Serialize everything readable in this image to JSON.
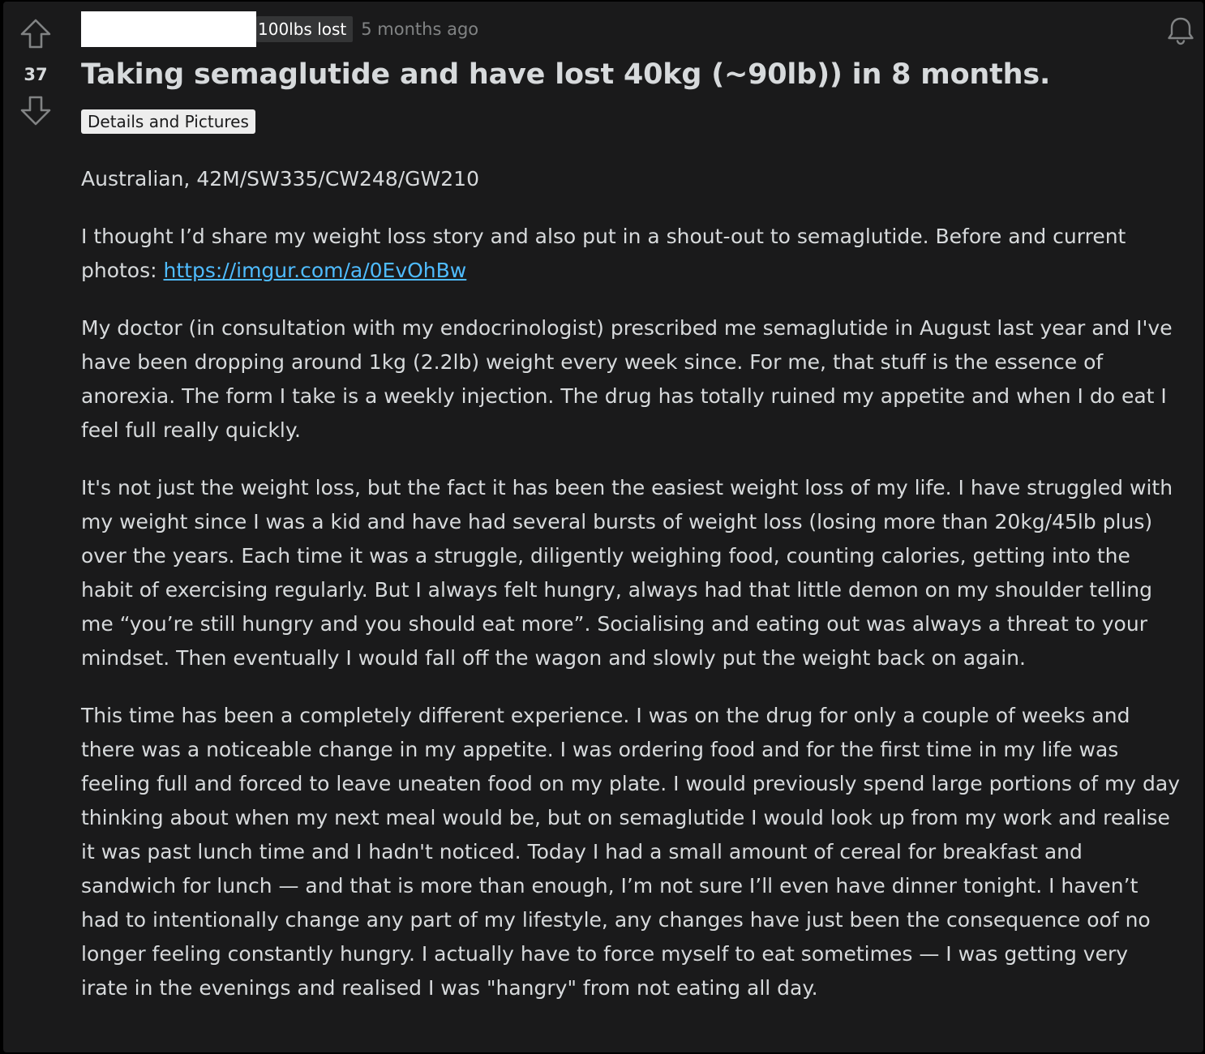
{
  "post": {
    "vote_count": "37",
    "author_flair": "100lbs lost",
    "time_ago": "5 months ago",
    "title": "Taking semaglutide and have lost 40kg (~90lb)) in 8 months.",
    "post_flair": "Details and Pictures",
    "body": {
      "p1": "Australian, 42M/SW335/CW248/GW210",
      "p2_text": "I thought I’d share my weight loss story and also put in a shout-out to semaglutide. Before and current photos: ",
      "p2_link": "https://imgur.com/a/0EvOhBw",
      "p3": "My doctor (in consultation with my endocrinologist) prescribed me semaglutide in August last year and I've have been dropping around 1kg (2.2lb) weight every week since. For me, that stuff is the essence of anorexia. The form I take is a weekly injection. The drug has totally ruined my appetite and when I do eat I feel full really quickly.",
      "p4": "It's not just the weight loss, but the fact it has been the easiest weight loss of my life. I have struggled with my weight since I was a kid and have had several bursts of weight loss (losing more than 20kg/45lb plus) over the years. Each time it was a struggle, diligently weighing food, counting calories, getting into the habit of exercising regularly. But I always felt hungry, always had that little demon on my shoulder telling me “you’re still hungry and you should eat more”. Socialising and eating out was always a threat to your mindset. Then eventually I would fall off the wagon and slowly put the weight back on again.",
      "p5": "This time has been a completely different experience. I was on the drug for only a couple of weeks and there was a noticeable change in my appetite. I was ordering food and for the first time in my life was feeling full and forced to leave uneaten food on my plate. I would previously spend large portions of my day thinking about when my next meal would be, but on semaglutide I would look up from my work and realise it was past lunch time and I hadn't noticed. Today I had a small amount of cereal for breakfast and sandwich for lunch — and that is more than enough, I’m not sure I’ll even have dinner tonight. I haven’t had to intentionally change any part of my lifestyle, any changes have just been the consequence oof no longer feeling constantly hungry. I actually have to force myself to eat sometimes — I was getting very irate in the evenings and realised I was \"hangry\" from not eating all day."
    }
  },
  "icons": {
    "upvote": "upvote-arrow-icon",
    "downvote": "downvote-arrow-icon",
    "notify": "bell-icon"
  },
  "colors": {
    "background": "#1a1a1b",
    "text": "#d7dadc",
    "muted": "#818384",
    "link": "#4fbcff",
    "flair_bg": "#ededed"
  }
}
